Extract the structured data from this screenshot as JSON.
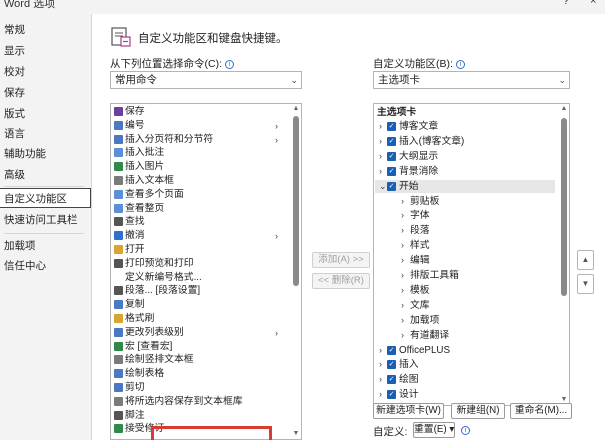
{
  "window": {
    "title": "Word 选项",
    "help": "?",
    "close": "×"
  },
  "sidebar": {
    "items": [
      {
        "label": "常规"
      },
      {
        "label": "显示"
      },
      {
        "label": "校对"
      },
      {
        "label": "保存"
      },
      {
        "label": "版式"
      },
      {
        "label": "语言"
      },
      {
        "label": "辅助功能"
      },
      {
        "label": "高级"
      },
      {
        "label": "自定义功能区",
        "selected": true
      },
      {
        "label": "快速访问工具栏"
      },
      {
        "label": "加载项"
      },
      {
        "label": "信任中心"
      }
    ]
  },
  "header": {
    "title": "自定义功能区和键盘快捷键。"
  },
  "left_panel": {
    "label": "从下列位置选择命令(C):",
    "info": "i",
    "combo_value": "常用命令",
    "commands": [
      {
        "label": "保存",
        "icon": "save-icon",
        "color": "#6b3fa0"
      },
      {
        "label": "编号",
        "icon": "numbering-icon",
        "color": "#4a78c2",
        "submenu": true
      },
      {
        "label": "插入分页符和分节符",
        "icon": "page-break-icon",
        "color": "#4a78c2",
        "submenu": true
      },
      {
        "label": "插入批注",
        "icon": "comment-icon",
        "color": "#5b8fd6"
      },
      {
        "label": "插入图片",
        "icon": "picture-icon",
        "color": "#2f8a4a"
      },
      {
        "label": "插入文本框",
        "icon": "textbox-icon",
        "color": "#7a7a7a"
      },
      {
        "label": "查看多个页面",
        "icon": "multi-page-icon",
        "color": "#5b8fd6"
      },
      {
        "label": "查看整页",
        "icon": "one-page-icon",
        "color": "#5b8fd6"
      },
      {
        "label": "查找",
        "icon": "find-icon",
        "color": "#555555"
      },
      {
        "label": "撤消",
        "icon": "undo-icon",
        "color": "#2e6fd0",
        "submenu": true
      },
      {
        "label": "打开",
        "icon": "open-icon",
        "color": "#d9a531"
      },
      {
        "label": "打印预览和打印",
        "icon": "print-icon",
        "color": "#555555"
      },
      {
        "label": "定义新编号格式...",
        "icon": "",
        "color": ""
      },
      {
        "label": "段落... [段落设置]",
        "icon": "paragraph-icon",
        "color": "#555555"
      },
      {
        "label": "复制",
        "icon": "copy-icon",
        "color": "#4a78c2"
      },
      {
        "label": "格式刷",
        "icon": "format-painter-icon",
        "color": "#d9a531"
      },
      {
        "label": "更改列表级别",
        "icon": "list-level-icon",
        "color": "#4a78c2",
        "submenu": true
      },
      {
        "label": "宏 [查看宏]",
        "icon": "macro-icon",
        "color": "#2f8a4a"
      },
      {
        "label": "绘制竖排文本框",
        "icon": "vertical-textbox-icon",
        "color": "#7a7a7a"
      },
      {
        "label": "绘制表格",
        "icon": "draw-table-icon",
        "color": "#4a78c2"
      },
      {
        "label": "剪切",
        "icon": "cut-icon",
        "color": "#4a78c2"
      },
      {
        "label": "将所选内容保存到文本框库",
        "icon": "save-selection-icon",
        "color": "#7a7a7a"
      },
      {
        "label": "脚注",
        "icon": "footnote-icon",
        "color": "#555555"
      },
      {
        "label": "接受修订",
        "icon": "accept-changes-icon",
        "color": "#2f8a4a"
      }
    ]
  },
  "middle": {
    "add_label": "添加(A) >>",
    "remove_label": "<< 删除(R)"
  },
  "right_panel": {
    "label": "自定义功能区(B):",
    "info": "i",
    "combo_value": "主选项卡",
    "tree_header": "主选项卡",
    "tree": [
      {
        "label": "博客文章",
        "level": 1,
        "expander": ">",
        "checked": true
      },
      {
        "label": "插入(博客文章)",
        "level": 1,
        "expander": ">",
        "checked": true
      },
      {
        "label": "大纲显示",
        "level": 1,
        "expander": ">",
        "checked": true
      },
      {
        "label": "背景消除",
        "level": 1,
        "expander": ">",
        "checked": true
      },
      {
        "label": "开始",
        "level": 1,
        "expander": "v",
        "checked": true,
        "selected": true
      },
      {
        "label": "剪贴板",
        "level": 2,
        "expander": ">"
      },
      {
        "label": "字体",
        "level": 2,
        "expander": ">"
      },
      {
        "label": "段落",
        "level": 2,
        "expander": ">"
      },
      {
        "label": "样式",
        "level": 2,
        "expander": ">"
      },
      {
        "label": "编辑",
        "level": 2,
        "expander": ">"
      },
      {
        "label": "排版工具箱",
        "level": 2,
        "expander": ">"
      },
      {
        "label": "模板",
        "level": 2,
        "expander": ">"
      },
      {
        "label": "文库",
        "level": 2,
        "expander": ">"
      },
      {
        "label": "加载项",
        "level": 2,
        "expander": ">"
      },
      {
        "label": "有道翻译",
        "level": 2,
        "expander": ">"
      },
      {
        "label": "OfficePLUS",
        "level": 1,
        "expander": ">",
        "checked": true
      },
      {
        "label": "插入",
        "level": 1,
        "expander": ">",
        "checked": true
      },
      {
        "label": "绘图",
        "level": 1,
        "expander": ">",
        "checked": true
      },
      {
        "label": "设计",
        "level": 1,
        "expander": ">",
        "checked": true
      }
    ],
    "new_tab_button": "新建选项卡(W)",
    "new_group_button": "新建组(N)",
    "rename_button": "重命名(M)...",
    "customize_label": "自定义:",
    "reset_button": "重置(E) ▾"
  },
  "accent": {
    "checkbox": "#1a5fb4",
    "highlight_box": "#d93a32"
  }
}
